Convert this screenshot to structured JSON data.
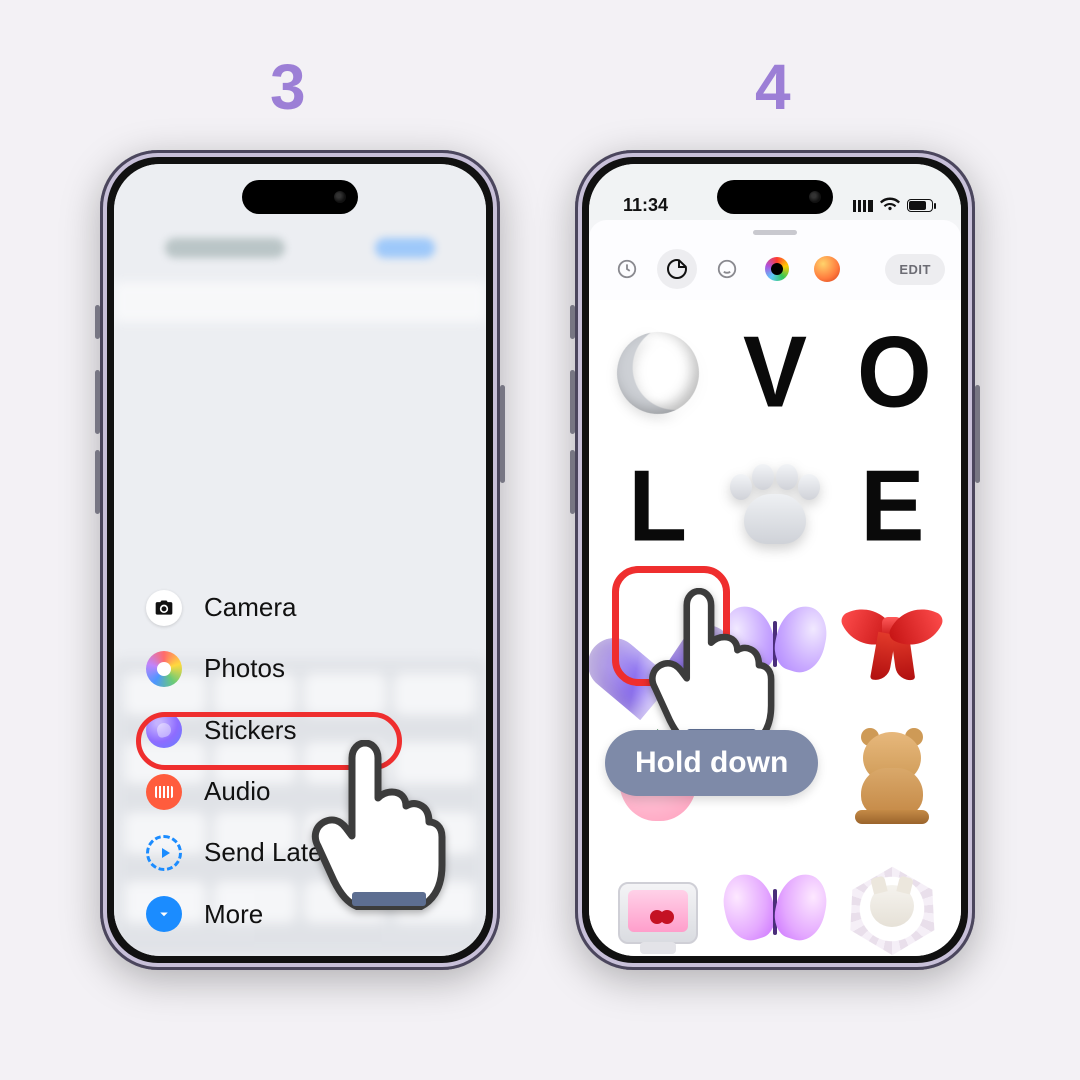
{
  "steps": {
    "left": "3",
    "right": "4"
  },
  "left": {
    "sheet": {
      "camera": "Camera",
      "photos": "Photos",
      "stickers": "Stickers",
      "audio": "Audio",
      "later": "Send Later",
      "more": "More"
    }
  },
  "right": {
    "status": {
      "time": "11:34"
    },
    "tabs": {
      "edit": "EDIT",
      "icons": [
        "recents-icon",
        "sticker-pack-icon",
        "memoji-icon",
        "live-sticker-icon",
        "app-sticker-icon"
      ]
    },
    "stickers": [
      "moon-sticker",
      "letter-v-sticker",
      "letter-o-sticker",
      "letter-l-sticker",
      "paw-sticker",
      "letter-e-sticker",
      "heart-sticker",
      "butterfly-sticker",
      "bow-sticker",
      "strawberry-sticker",
      "_hidden",
      "bear-sticker",
      "retro-tv-sticker",
      "pink-butterfly-sticker",
      "cat-heart-sticker"
    ],
    "hint": "Hold down"
  }
}
